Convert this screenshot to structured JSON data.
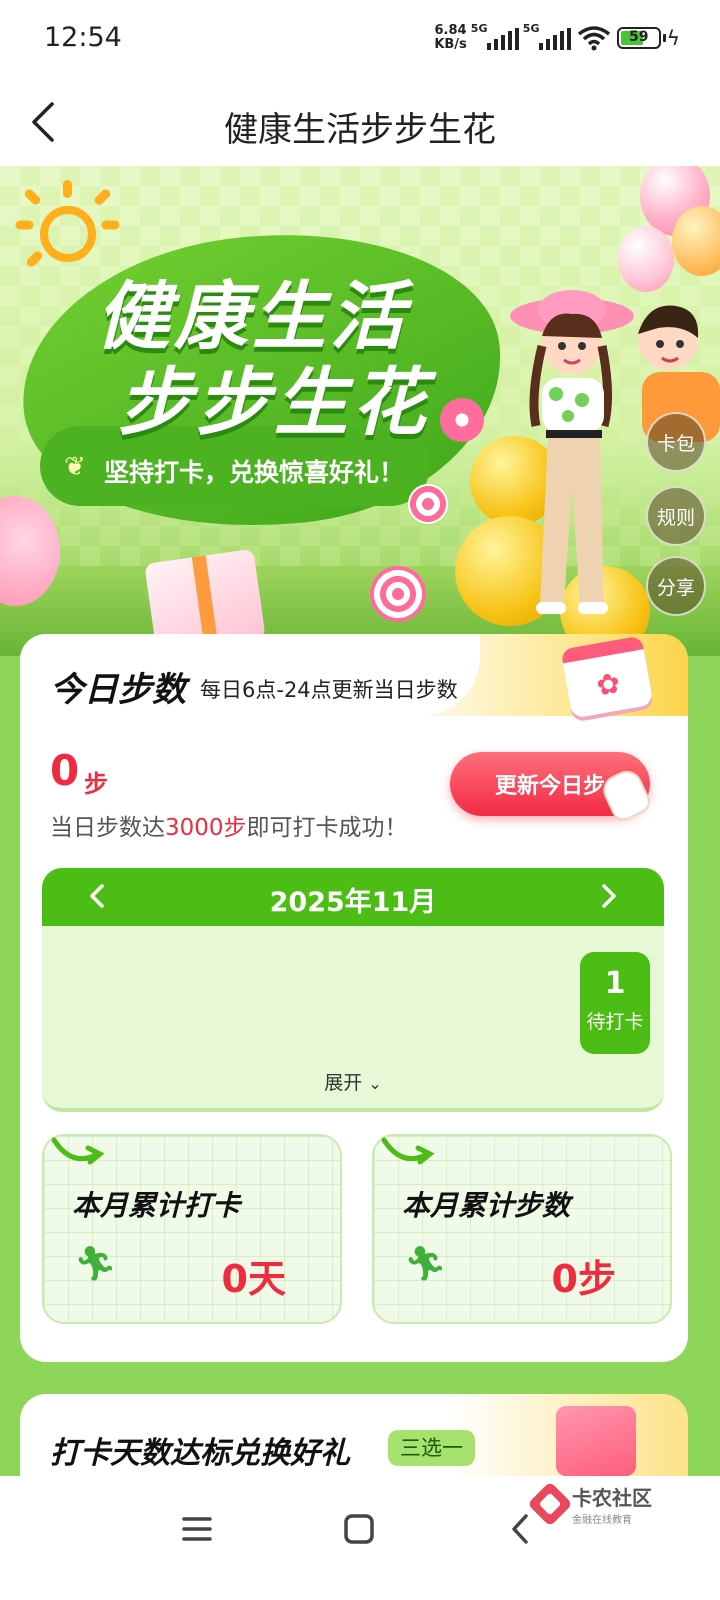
{
  "status_bar": {
    "time": "12:54",
    "net_speed_value": "6.84",
    "net_speed_unit": "KB/s",
    "sim1": "5G",
    "sim2": "5G",
    "battery": "59"
  },
  "header": {
    "title": "健康生活步步生花"
  },
  "banner": {
    "title_line1": "健康生活",
    "title_line2": "步步生花",
    "subtitle": "坚持打卡，兑换惊喜好礼！",
    "side_buttons": [
      "卡包",
      "规则",
      "分享"
    ]
  },
  "today": {
    "title": "今日步数",
    "subtitle": "每日6点-24点更新当日步数",
    "steps": "0",
    "steps_unit": "步",
    "hint_prefix": "当日步数达",
    "hint_highlight": "3000步",
    "hint_suffix": "即可打卡成功！",
    "update_button": "更新今日步"
  },
  "calendar": {
    "month": "2025年11月",
    "day_number": "1",
    "day_status": "待打卡",
    "expand_label": "展开"
  },
  "stats": [
    {
      "label": "本月累计打卡",
      "value": "0天"
    },
    {
      "label": "本月累计步数",
      "value": "0步"
    }
  ],
  "rewards": {
    "title": "打卡天数达标兑换好礼",
    "badge": "三选一"
  },
  "watermark": {
    "title": "卡农社区",
    "subtitle": "金融在线教育"
  },
  "colors": {
    "brand_green": "#4cbd14",
    "accent_red": "#ef2c3f",
    "page_bg": "#8ed65a"
  }
}
